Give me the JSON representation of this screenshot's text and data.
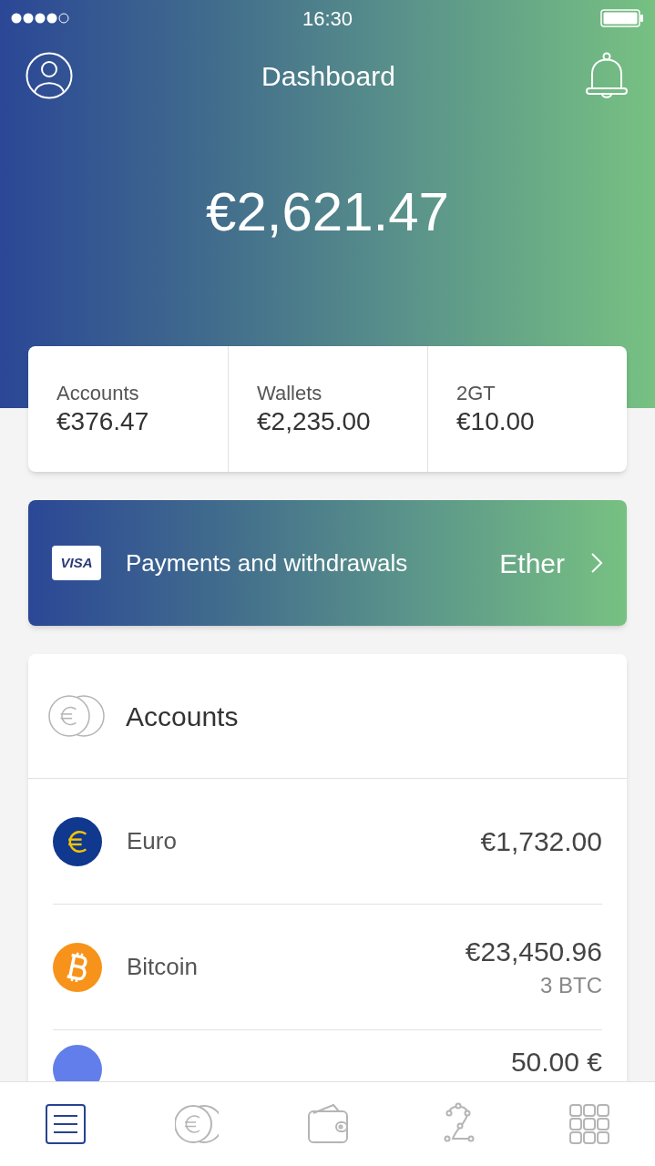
{
  "status_bar": {
    "time": "16:30"
  },
  "header": {
    "title": "Dashboard",
    "total": "€2,621.47"
  },
  "summary": [
    {
      "label": "Accounts",
      "value": "€376.47"
    },
    {
      "label": "Wallets",
      "value": "€2,235.00"
    },
    {
      "label": "2GT",
      "value": "€10.00"
    }
  ],
  "payments_banner": {
    "card": "VISA",
    "label": "Payments and withdrawals",
    "currency": "Ether"
  },
  "accounts": {
    "title": "Accounts",
    "rows": [
      {
        "kind": "euro",
        "name": "Euro",
        "amount": "€1,732.00"
      },
      {
        "kind": "bitcoin",
        "name": "Bitcoin",
        "amount": "€23,450.96",
        "sub": "3 BTC"
      },
      {
        "kind": "ether",
        "amount": "50.00 €"
      }
    ]
  },
  "tab_bar": [
    {
      "kind": "list",
      "selected": true
    },
    {
      "kind": "coins",
      "selected": false
    },
    {
      "kind": "wallet",
      "selected": false
    },
    {
      "kind": "route",
      "selected": false
    },
    {
      "kind": "grid",
      "selected": false
    }
  ]
}
